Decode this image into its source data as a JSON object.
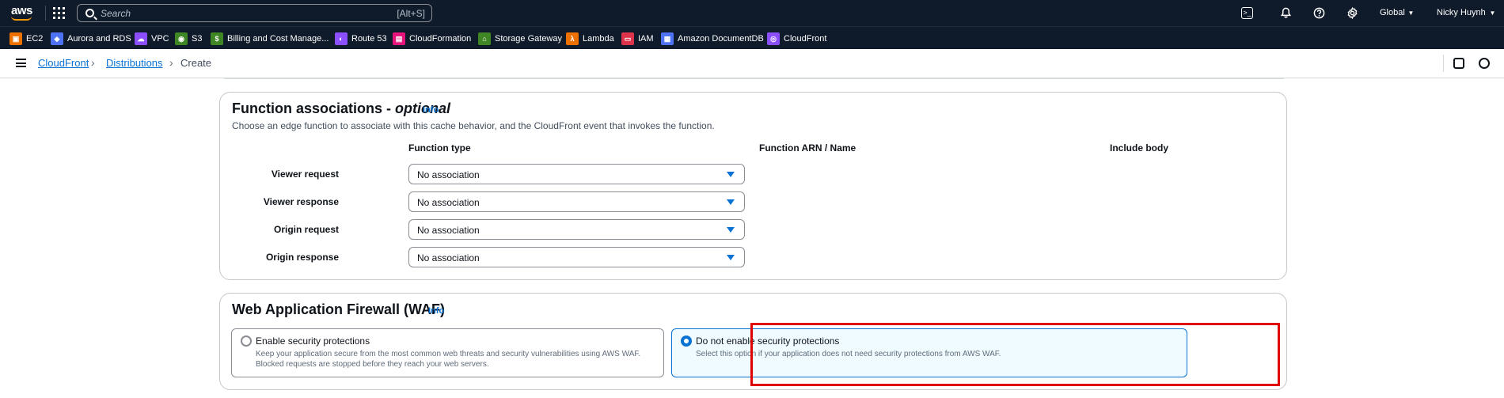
{
  "topbar": {
    "search_placeholder": "Search",
    "search_shortcut": "[Alt+S]",
    "region": "Global",
    "user": "Nicky Huynh",
    "icons": [
      "cloudshell-icon",
      "bell-icon",
      "help-icon",
      "gear-icon"
    ]
  },
  "favorites": [
    {
      "label": "EC2",
      "color": "#ed7100"
    },
    {
      "label": "Aurora and RDS",
      "color": "#4d72f3"
    },
    {
      "label": "VPC",
      "color": "#8c4fff"
    },
    {
      "label": "S3",
      "color": "#3f8624"
    },
    {
      "label": "Billing and Cost Manage...",
      "color": "#3f8624"
    },
    {
      "label": "Route 53",
      "color": "#8c4fff"
    },
    {
      "label": "CloudFormation",
      "color": "#e7157b"
    },
    {
      "label": "Storage Gateway",
      "color": "#3f8624"
    },
    {
      "label": "Lambda",
      "color": "#ed7100"
    },
    {
      "label": "IAM",
      "color": "#dd344c"
    },
    {
      "label": "Amazon DocumentDB",
      "color": "#4d72f3"
    },
    {
      "label": "CloudFront",
      "color": "#8c4fff"
    }
  ],
  "breadcrumb": {
    "items": [
      "CloudFront",
      "Distributions",
      "Create"
    ]
  },
  "function_associations": {
    "title": "Function associations -",
    "title_optional": "optional",
    "info": "Info",
    "description": "Choose an edge function to associate with this cache behavior, and the CloudFront event that invokes the function.",
    "columns": [
      "Function type",
      "Function ARN / Name",
      "Include body"
    ],
    "rows": [
      {
        "label": "Viewer request",
        "value": "No association"
      },
      {
        "label": "Viewer response",
        "value": "No association"
      },
      {
        "label": "Origin request",
        "value": "No association"
      },
      {
        "label": "Origin response",
        "value": "No association"
      }
    ]
  },
  "waf": {
    "title": "Web Application Firewall (WAF)",
    "info": "Info",
    "options": [
      {
        "title": "Enable security protections",
        "description": "Keep your application secure from the most common web threats and security vulnerabilities using AWS WAF. Blocked requests are stopped before they reach your web servers.",
        "selected": false
      },
      {
        "title": "Do not enable security protections",
        "description": "Select this option if your application does not need security protections from AWS WAF.",
        "selected": true
      }
    ]
  }
}
